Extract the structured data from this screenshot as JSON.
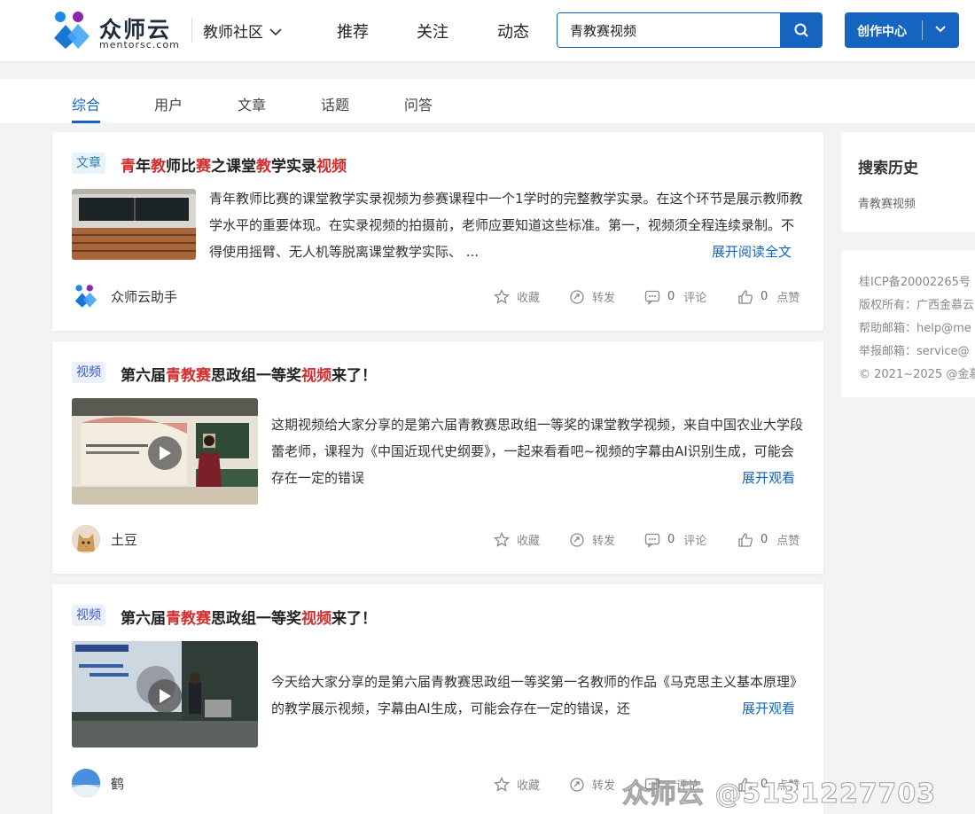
{
  "header": {
    "logo_cn": "众师云",
    "logo_en": "mentorsc.com",
    "community_label": "教师社区",
    "nav": [
      "推荐",
      "关注",
      "动态"
    ],
    "search_value": "青教赛视频",
    "create_label": "创作中心"
  },
  "tabs": [
    "综合",
    "用户",
    "文章",
    "话题",
    "问答"
  ],
  "active_tab": "综合",
  "colors": {
    "accent": "#1565c0",
    "highlight": "#d32f2f"
  },
  "cards": [
    {
      "tag": "文章",
      "title_parts": [
        "青",
        "年",
        "教",
        "师比",
        "赛",
        "之课堂",
        "教",
        "学实录",
        "视频"
      ],
      "description": "青年教师比赛的课堂教学实录视频为参赛课程中一个1学时的完整教学实录。在这个环节是展示教师教学水平的重要体现。在实录视频的拍摄前，老师应要知道这些标准。第一，视频须全程连续录制。不得使用摇臂、无人机等脱离课堂教学实际、 ...",
      "more_label": "展开阅读全文",
      "author": "众师云助手",
      "actions": {
        "collect": "收藏",
        "share": "转发",
        "comment_count": "0",
        "comment": "评论",
        "like_count": "0",
        "like": "点赞"
      }
    },
    {
      "tag": "视频",
      "title_parts": [
        "第六届",
        "青教赛",
        "思政组一等奖",
        "视频",
        "来了！"
      ],
      "description": "这期视频给大家分享的是第六届青教赛思政组一等奖的课堂教学视频，来自中国农业大学段蕾老师，课程为《中国近现代史纲要》，一起来看看吧~视频的字幕由AI识别生成，可能会存在一定的错误",
      "more_label": "展开观看",
      "author": "土豆",
      "actions": {
        "collect": "收藏",
        "share": "转发",
        "comment_count": "0",
        "comment": "评论",
        "like_count": "0",
        "like": "点赞"
      }
    },
    {
      "tag": "视频",
      "title_parts": [
        "第六届",
        "青教赛",
        "思政组一等奖",
        "视频",
        "来了！"
      ],
      "description": "今天给大家分享的是第六届青教赛思政组一等奖第一名教师的作品《马克思主义基本原理》的教学展示视频，字幕由AI生成，可能会存在一定的错误，还",
      "more_label": "展开观看",
      "author": "鹤",
      "actions": {
        "collect": "收藏",
        "share": "转发",
        "comment_count": "",
        "comment": "评论",
        "like_count": "0",
        "like": "点赞"
      }
    }
  ],
  "sidebar": {
    "history_title": "搜索历史",
    "history_items": [
      "青教赛视频"
    ],
    "footer_lines": [
      "桂ICP备20002265号",
      "版权所有：广西金慕云",
      "帮助邮箱：help@me",
      "举报邮箱：service@",
      "© 2021~2025 @金慕"
    ]
  },
  "watermark": "众师云 @5131227703"
}
